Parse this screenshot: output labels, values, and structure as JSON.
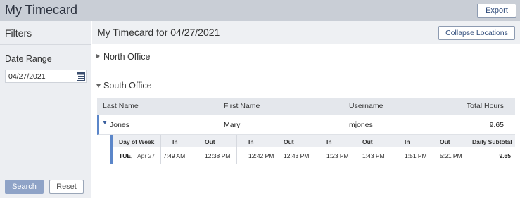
{
  "app": {
    "title": "My Timecard",
    "export_label": "Export"
  },
  "sidebar": {
    "title": "Filters",
    "date_range_label": "Date Range",
    "date_value": "04/27/2021",
    "search_label": "Search",
    "reset_label": "Reset"
  },
  "main": {
    "title": "My Timecard for 04/27/2021",
    "collapse_label": "Collapse Locations",
    "locations": [
      {
        "name": "North Office",
        "expanded": false
      },
      {
        "name": "South Office",
        "expanded": true
      }
    ]
  },
  "grid": {
    "columns": [
      "Last Name",
      "First Name",
      "Username",
      "Total Hours"
    ],
    "rows": [
      {
        "last_name": "Jones",
        "first_name": "Mary",
        "username": "mjones",
        "total_hours": "9.65"
      }
    ]
  },
  "detail": {
    "columns": [
      "Day of Week",
      "In",
      "Out",
      "In",
      "Out",
      "In",
      "Out",
      "In",
      "Out",
      "Daily Subtotal"
    ],
    "day": "TUE,",
    "date": "Apr 27",
    "times": [
      "7:49 AM",
      "12:38 PM",
      "12:42 PM",
      "12:43 PM",
      "1:23 PM",
      "1:43 PM",
      "1:51 PM",
      "5:21 PM"
    ],
    "subtotal": "9.65"
  },
  "colors": {
    "accent": "#5b86c9",
    "topbar": "#c9ced6",
    "sidebar": "#eceef2",
    "search_button": "#8fa3c7"
  }
}
